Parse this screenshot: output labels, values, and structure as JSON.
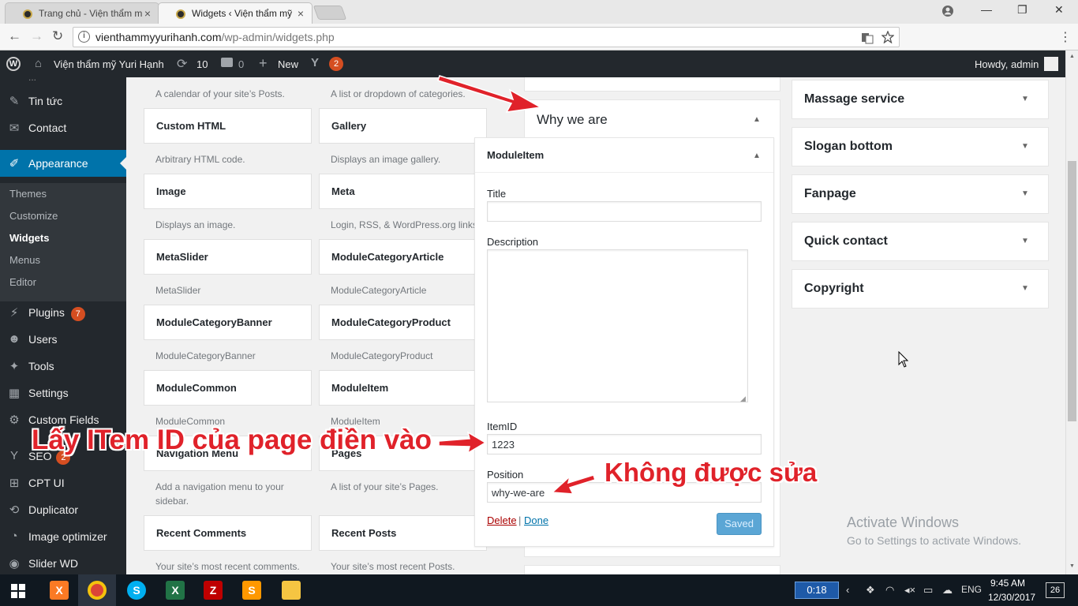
{
  "browser": {
    "tabs": [
      {
        "title": "Trang chủ - Viện thẩm m",
        "close": "×"
      },
      {
        "title": "Widgets ‹ Viện thẩm mỹ",
        "close": "×"
      }
    ],
    "window_controls": {
      "minimize": "—",
      "restore": "❐",
      "close": "✕"
    },
    "url_host": "vienthammyyurihanh.com",
    "url_path": "/wp-admin/widgets.php",
    "nav": {
      "back": "←",
      "forward": "→",
      "reload": "↻"
    }
  },
  "adminbar": {
    "wp_logo": "W",
    "site_name": "Viện thẩm mỹ Yuri Hạnh",
    "updates_count": "10",
    "comments_count": "0",
    "new_label": "New",
    "yoast_count": "2",
    "howdy": "Howdy, admin"
  },
  "sidebar": {
    "items": [
      {
        "label": "Tin tức",
        "icon": "pin-icon"
      },
      {
        "label": "Contact",
        "icon": "mail-icon"
      },
      {
        "label": "Appearance",
        "icon": "brush-icon"
      },
      {
        "label": "Plugins",
        "icon": "plugin-icon",
        "badge": "7"
      },
      {
        "label": "Users",
        "icon": "user-icon"
      },
      {
        "label": "Tools",
        "icon": "wrench-icon"
      },
      {
        "label": "Settings",
        "icon": "settings-icon"
      },
      {
        "label": "Custom Fields",
        "icon": "fields-icon"
      },
      {
        "label": "SEO",
        "icon": "yoast-icon",
        "badge": "2"
      },
      {
        "label": "CPT UI",
        "icon": "grid-icon"
      },
      {
        "label": "Duplicator",
        "icon": "duplicator-icon"
      },
      {
        "label": "Image optimizer",
        "icon": "gauge-icon"
      },
      {
        "label": "Slider WD",
        "icon": "eye-icon"
      }
    ],
    "submenu": [
      "Themes",
      "Customize",
      "Widgets",
      "Menus",
      "Editor"
    ]
  },
  "available_widgets": {
    "top_desc_left": "A calendar of your site’s Posts.",
    "top_desc_right": "A list or dropdown of categories.",
    "rows": [
      {
        "left": {
          "name": "Custom HTML",
          "desc": "Arbitrary HTML code."
        },
        "right": {
          "name": "Gallery",
          "desc": "Displays an image gallery."
        }
      },
      {
        "left": {
          "name": "Image",
          "desc": "Displays an image."
        },
        "right": {
          "name": "Meta",
          "desc": "Login, RSS, & WordPress.org links."
        }
      },
      {
        "left": {
          "name": "MetaSlider",
          "desc": "MetaSlider"
        },
        "right": {
          "name": "ModuleCategoryArticle",
          "desc": "ModuleCategoryArticle"
        }
      },
      {
        "left": {
          "name": "ModuleCategoryBanner",
          "desc": "ModuleCategoryBanner"
        },
        "right": {
          "name": "ModuleCategoryProduct",
          "desc": "ModuleCategoryProduct"
        }
      },
      {
        "left": {
          "name": "ModuleCommon",
          "desc": "ModuleCommon"
        },
        "right": {
          "name": "ModuleItem",
          "desc": "ModuleItem"
        }
      },
      {
        "left": {
          "name": "Navigation Menu",
          "desc": "Add a navigation menu to your sidebar."
        },
        "right": {
          "name": "Pages",
          "desc": "A list of your site’s Pages."
        }
      },
      {
        "left": {
          "name": "Recent Comments",
          "desc": "Your site’s most recent comments."
        },
        "right": {
          "name": "Recent Posts",
          "desc": "Your site’s most recent Posts."
        }
      }
    ]
  },
  "sidebar_area": {
    "title": "Why we are",
    "widget": {
      "title": "ModuleItem",
      "fields": {
        "title_label": "Title",
        "title_value": "",
        "description_label": "Description",
        "description_value": "",
        "itemid_label": "ItemID",
        "itemid_value": "1223",
        "position_label": "Position",
        "position_value": "why-we-are"
      },
      "delete_label": "Delete",
      "separator": "|",
      "done_label": "Done",
      "saved_label": "Saved"
    }
  },
  "right_sidebars": [
    "Massage service",
    "Slogan bottom",
    "Fanpage",
    "Quick contact",
    "Copyright"
  ],
  "annotations": {
    "itemid_note": "Lấy ITem ID của page điền vào",
    "position_note": "Không được sửa"
  },
  "watermark": {
    "title": "Activate Windows",
    "subtitle": "Go to Settings to activate Windows."
  },
  "taskbar": {
    "timer": "0:18",
    "lang": "ENG",
    "time": "9:45 AM",
    "date": "12/30/2017",
    "notification_count": "26"
  },
  "colors": {
    "admin_bg": "#23282d",
    "accent": "#0073aa",
    "badge": "#d54e21",
    "annotation": "#e0222a"
  }
}
